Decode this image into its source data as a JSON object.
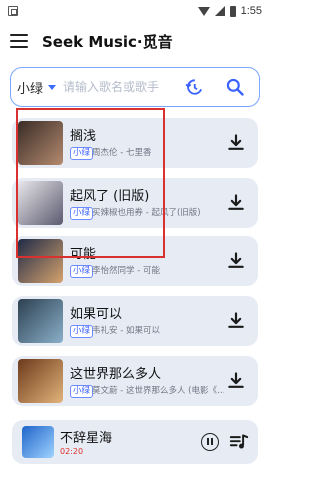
{
  "status_bar": {
    "time": "1:55"
  },
  "app": {
    "title": "Seek Music·觅音"
  },
  "search": {
    "source": "小绿",
    "placeholder": "请输入歌名或歌手"
  },
  "songs": [
    {
      "title": "搁浅",
      "tag": "小绿",
      "subtitle": "周杰伦 - 七里香",
      "cover_colors": [
        "#3a2c27",
        "#b48a6f"
      ]
    },
    {
      "title": "起风了 (旧版)",
      "tag": "小绿",
      "subtitle": "买辣椒也用券 - 起风了(旧版)",
      "cover_colors": [
        "#e9e7ea",
        "#5b5a70"
      ]
    },
    {
      "title": "可能",
      "tag": "小绿",
      "subtitle": "李怡然同学 - 可能",
      "cover_colors": [
        "#1e2a48",
        "#d6a36c"
      ]
    },
    {
      "title": "如果可以",
      "tag": "小绿",
      "subtitle": "韦礼安 - 如果可以",
      "cover_colors": [
        "#2d4051",
        "#8ab0c9"
      ]
    },
    {
      "title": "这世界那么多人",
      "tag": "小绿",
      "subtitle": "莫文蔚 - 这世界那么多人 (电影《…",
      "cover_colors": [
        "#6d3a1c",
        "#e2b47a"
      ]
    }
  ],
  "now_playing": {
    "title": "不辞星海",
    "time": "02:20",
    "cover_colors": [
      "#1f64c9",
      "#9fd3ff"
    ]
  },
  "colors": {
    "accent": "#3b62ff",
    "card_bg": "#e6ebf4",
    "highlight": "#d93030",
    "time_red": "#e0302c"
  }
}
